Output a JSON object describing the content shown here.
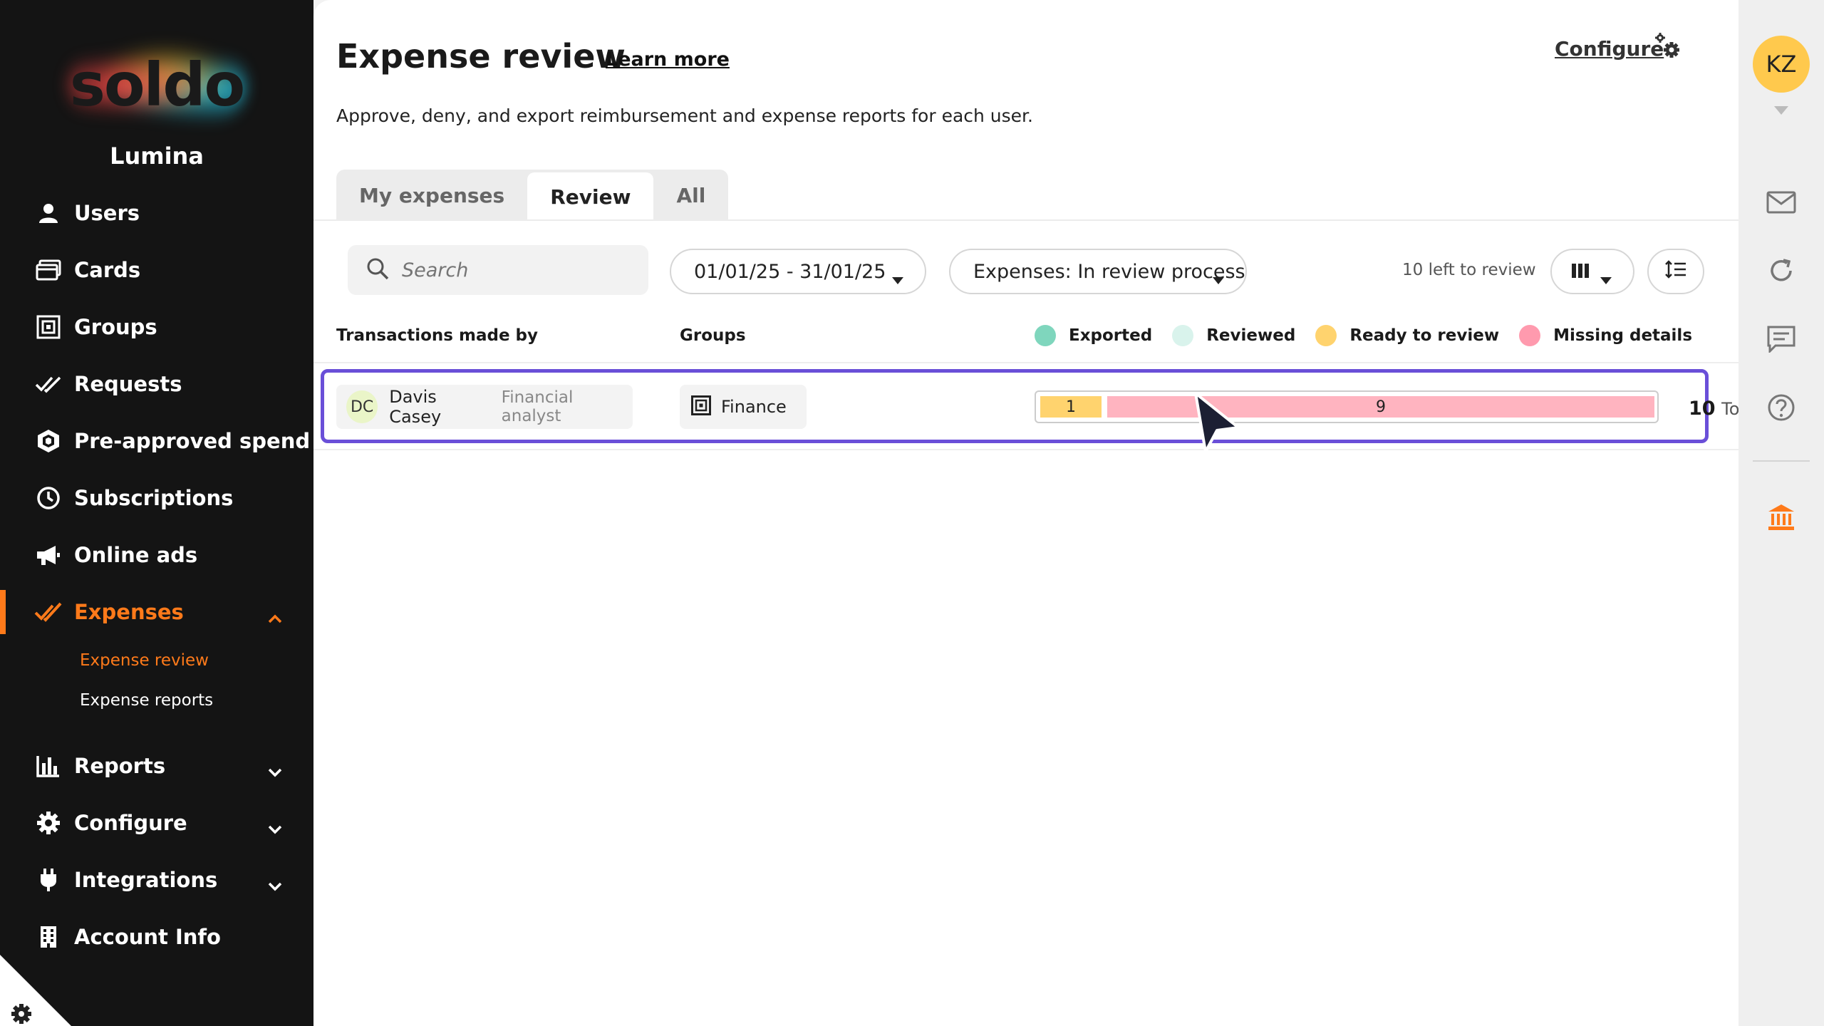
{
  "brand": {
    "logo_text": "soldo",
    "org_name": "Lumina"
  },
  "sidebar": {
    "items": [
      {
        "label": "Users",
        "icon": "user-icon"
      },
      {
        "label": "Cards",
        "icon": "cards-icon"
      },
      {
        "label": "Groups",
        "icon": "groups-icon"
      },
      {
        "label": "Requests",
        "icon": "requests-icon"
      },
      {
        "label": "Pre-approved spend",
        "icon": "shield-icon"
      },
      {
        "label": "Subscriptions",
        "icon": "clock-icon"
      },
      {
        "label": "Online ads",
        "icon": "megaphone-icon"
      },
      {
        "label": "Expenses",
        "icon": "checkmark-icon",
        "active": true,
        "expanded": true
      },
      {
        "label": "Reports",
        "icon": "bar-chart-icon"
      },
      {
        "label": "Configure",
        "icon": "gear-icon"
      },
      {
        "label": "Integrations",
        "icon": "plug-icon"
      },
      {
        "label": "Account Info",
        "icon": "building-icon"
      }
    ],
    "expenses_sub": [
      {
        "label": "Expense review",
        "active": true
      },
      {
        "label": "Expense reports"
      }
    ]
  },
  "header": {
    "title": "Expense review",
    "learn_more": "Learn more",
    "configure": "Configure",
    "description": "Approve, deny, and export reimbursement and expense reports for each user."
  },
  "tabs": [
    {
      "label": "My expenses"
    },
    {
      "label": "Review",
      "active": true
    },
    {
      "label": "All"
    }
  ],
  "filters": {
    "search_placeholder": "Search",
    "date_range": "01/01/25 - 31/01/25",
    "status": "Expenses: In review process",
    "left_to_review": "10 left to review"
  },
  "table": {
    "col_transactions": "Transactions made by",
    "col_groups": "Groups",
    "legend": [
      {
        "label": "Exported",
        "color": "#7fd6bd"
      },
      {
        "label": "Reviewed",
        "color": "#d9f3ec"
      },
      {
        "label": "Ready to review",
        "color": "#ffd36e"
      },
      {
        "label": "Missing details",
        "color": "#ff9aae"
      }
    ],
    "rows": [
      {
        "initials": "DC",
        "name": "Davis Casey",
        "role": "Financial analyst",
        "group": "Finance",
        "ready_count": "1",
        "missing_count": "9",
        "total": "10",
        "total_label": "Tot"
      }
    ]
  },
  "rail": {
    "avatar_initials": "KZ"
  },
  "colors": {
    "accent": "#ff7a1a",
    "highlight": "#6a4fd8",
    "sidebar_bg": "#141414"
  }
}
